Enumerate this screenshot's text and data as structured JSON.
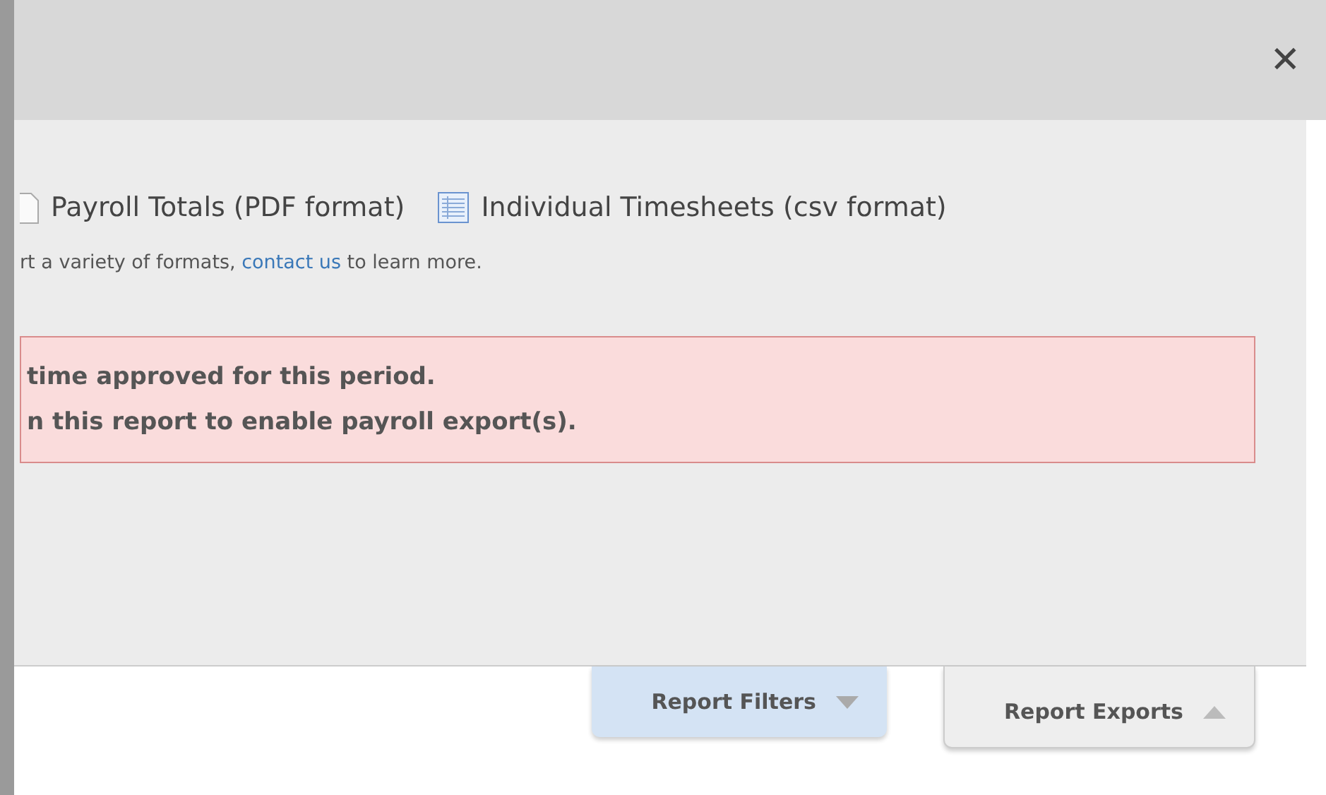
{
  "dialog": {
    "close_label": "✕"
  },
  "exports": [
    {
      "kind": "pdf",
      "label": "Payroll Totals (PDF format)"
    },
    {
      "kind": "csv",
      "label": "Individual Timesheets (csv format)"
    }
  ],
  "help_text": {
    "before": "rt a variety of formats, ",
    "link": "contact us",
    "after": " to learn more."
  },
  "alert": {
    "lines": [
      "time approved for this period.",
      "n this report to enable payroll export(s)."
    ]
  },
  "tabs": [
    {
      "label": "Report Filters",
      "selected": false
    },
    {
      "label": "Report Exports",
      "selected": true
    }
  ]
}
